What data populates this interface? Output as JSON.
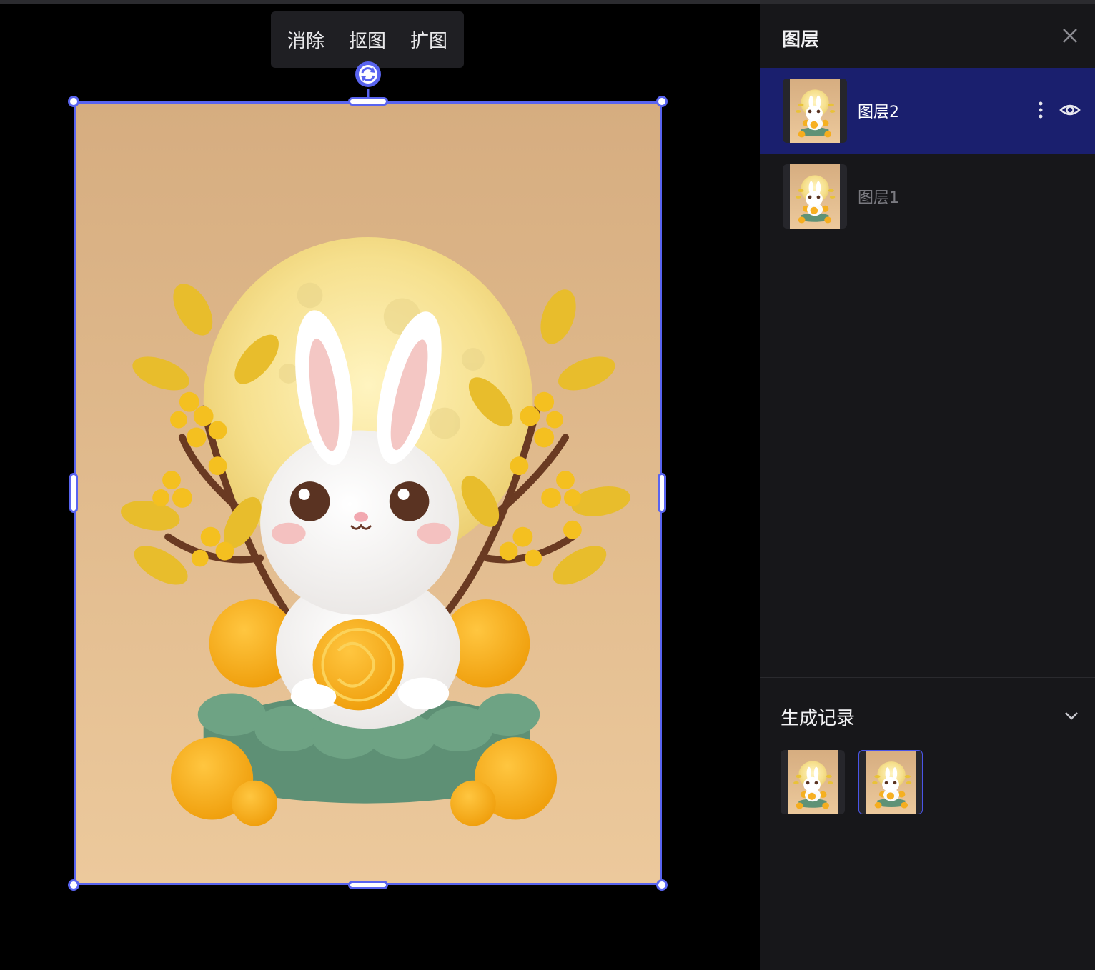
{
  "toolbar": {
    "erase_label": "消除",
    "cutout_label": "抠图",
    "expand_label": "扩图"
  },
  "panel": {
    "title": "图层",
    "close_icon": "close-icon"
  },
  "layers": [
    {
      "name": "图层2",
      "selected": true,
      "visible_icon": "eye-icon",
      "menu_icon": "more-vertical-icon"
    },
    {
      "name": "图层1",
      "selected": false
    }
  ],
  "history": {
    "title": "生成记录",
    "toggle_icon": "chevron-down-icon",
    "items": [
      {
        "selected": false
      },
      {
        "selected": true
      }
    ]
  },
  "colors": {
    "accent": "#5964f0",
    "selected_row": "#1a1f6e",
    "panel_bg": "#17171a",
    "canvas_bg": "#000000",
    "image_bg": "#d8ae82"
  }
}
